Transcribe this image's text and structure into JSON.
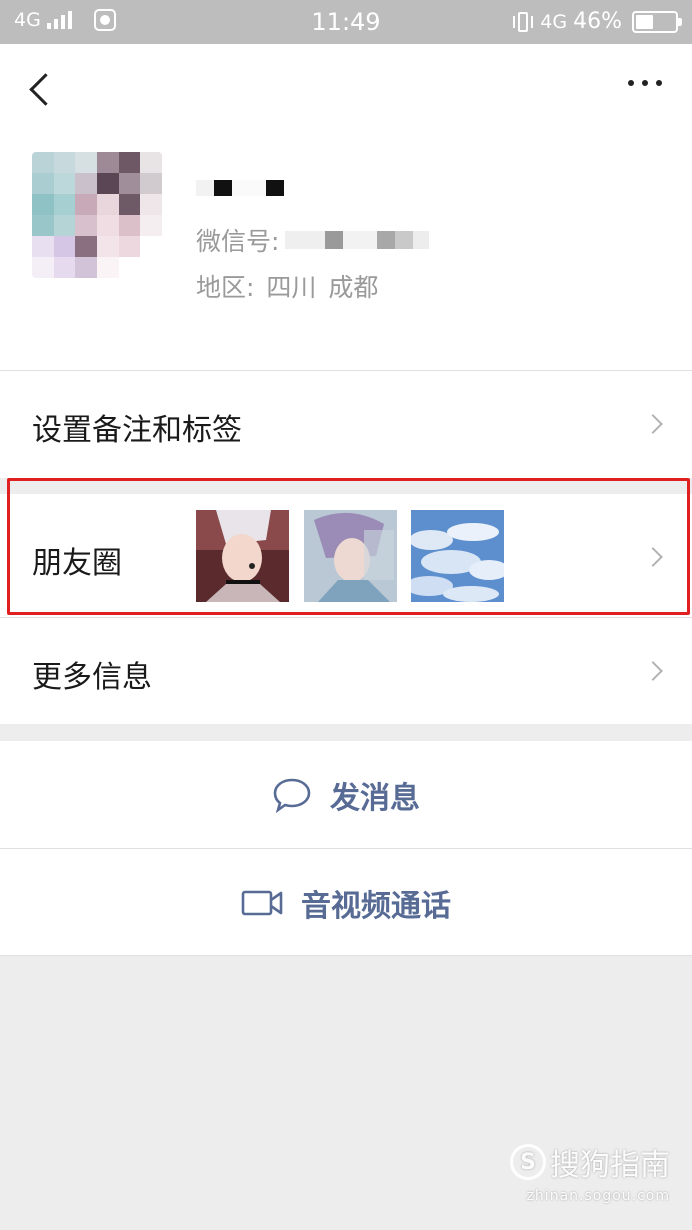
{
  "status_bar": {
    "network_left": "4G",
    "time": "11:49",
    "network_right": "4G",
    "battery": "46%",
    "battery_level": 0.46
  },
  "header": {
    "back_icon": "chevron-left-icon",
    "more_icon": "more-dots-icon"
  },
  "profile": {
    "wechat_id_label": "微信号:",
    "region_label": "地区:",
    "region_province": "四川",
    "region_city": "成都"
  },
  "rows": {
    "remark_tags": "设置备注和标签",
    "moments": "朋友圈",
    "more_info": "更多信息"
  },
  "actions": {
    "message": "发消息",
    "message_icon": "chat-bubble-icon",
    "video_call": "音视频通话",
    "video_call_icon": "video-camera-icon"
  },
  "colors": {
    "accent_link": "#576b95",
    "highlight_box": "#e02020",
    "status_bar_bg": "#bdbdbd",
    "page_bg": "#ededed"
  },
  "watermark": {
    "logo_letter": "S",
    "brand": "搜狗指南",
    "url": "zhinan.sogou.com"
  }
}
